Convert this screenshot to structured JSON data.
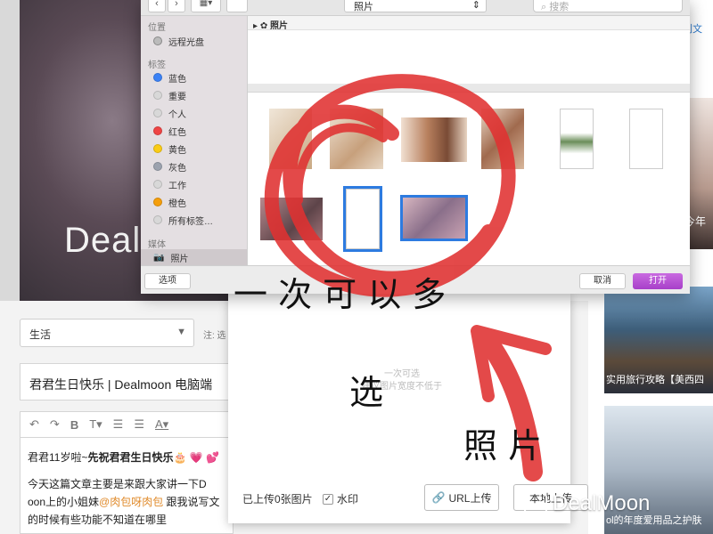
{
  "background": {
    "hero_text": "Deal",
    "right_column": {
      "link_1": "创文",
      "link_2": "",
      "year_caption": "今年",
      "travel_caption": "实用旅行攻略【美西四",
      "product_caption": "ol的年度爱用品之护肤"
    },
    "category_value": "生活",
    "note_text": "注: 选",
    "article_title": "君君生日快乐 | Dealmoon 电脑端",
    "editor_lines": {
      "line1_a": "君君11岁啦~",
      "line1_b": "先祝君君生日快乐",
      "line1_emoji": "🎂 💗 💕",
      "line2": "今天这篇文章主要是来跟大家讲一下D",
      "line3_a": "oon上的小姐妹",
      "line3_mention": "@肉包呀肉包",
      "line3_b": " 跟我说写文的时候有些功能不知道在哪里"
    }
  },
  "upload_dialog": {
    "hint_line1": "一次可选",
    "hint_line2": "建议图片宽度不低于",
    "status": "已上传0张图片",
    "watermark_label": "水印",
    "watermark_checked": true,
    "url_upload_label": "URL上传",
    "local_upload_label": "本地上传"
  },
  "file_picker": {
    "toolbar": {
      "back": "‹",
      "forward": "›",
      "location": "照片",
      "search_placeholder": "搜索"
    },
    "sidebar": {
      "section_locations": "位置",
      "remote_disc": "远程光盘",
      "section_tags": "标签",
      "tags": [
        {
          "label": "蓝色",
          "color": "#3b82f6"
        },
        {
          "label": "重要",
          "color": "#d8d8d8"
        },
        {
          "label": "个人",
          "color": "#d8d8d8"
        },
        {
          "label": "红色",
          "color": "#ef4444"
        },
        {
          "label": "黄色",
          "color": "#facc15"
        },
        {
          "label": "灰色",
          "color": "#9ca3af"
        },
        {
          "label": "工作",
          "color": "#d8d8d8"
        },
        {
          "label": "橙色",
          "color": "#f59e0b"
        },
        {
          "label": "所有标签…",
          "color": "#d8d8d8"
        }
      ],
      "section_media": "媒体",
      "photos": "照片"
    },
    "path_label": "照片",
    "buttons": {
      "options": "选项",
      "cancel": "取消",
      "open": "打开"
    }
  },
  "overlay": {
    "annotation": "一次可以多选照片",
    "brand": "DealMoon",
    "stroke_color": "#e03131"
  }
}
